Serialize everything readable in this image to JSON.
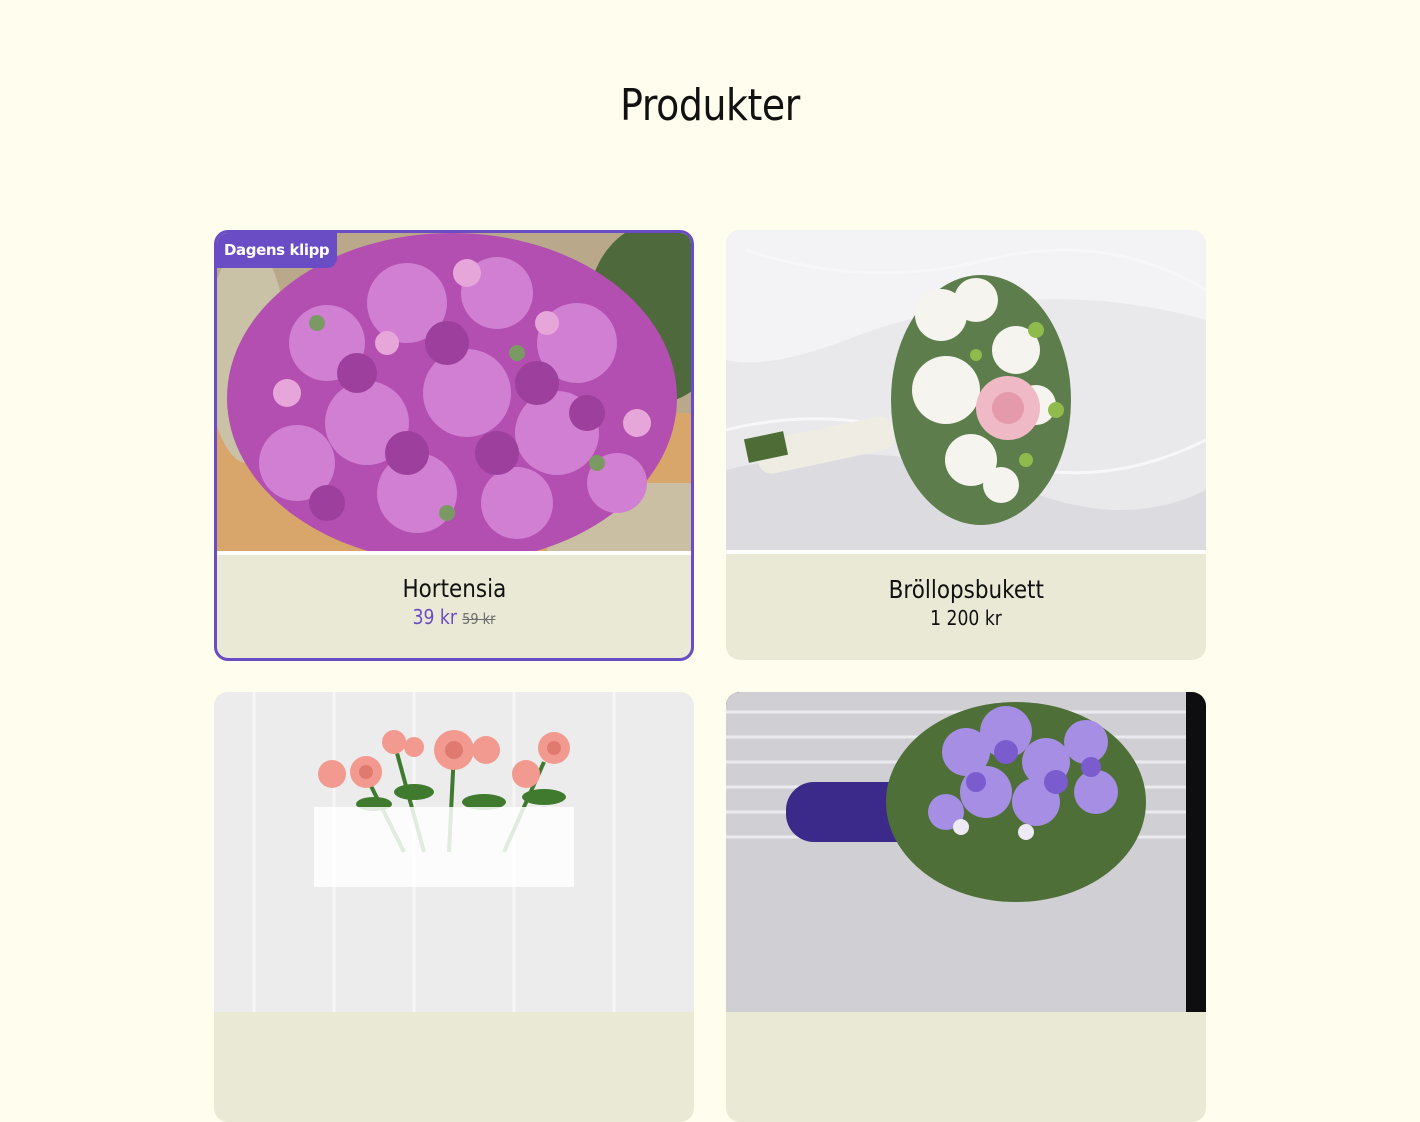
{
  "page": {
    "title": "Produkter"
  },
  "colors": {
    "background": "#fffeee",
    "card_info": "#eae9d5",
    "accent": "#6a4cc4"
  },
  "products": [
    {
      "name": "Hortensia",
      "price": "39 kr",
      "old_price": "59 kr",
      "badge": "Dagens klipp",
      "featured": true,
      "image": "purple hydrangea"
    },
    {
      "name": "Bröllopsbukett",
      "price": "1 200 kr",
      "featured": false,
      "image": "white wedding bouquet"
    },
    {
      "name": "",
      "featured": false,
      "image": "pink roses"
    },
    {
      "name": "",
      "featured": false,
      "image": "purple bouquet"
    }
  ]
}
